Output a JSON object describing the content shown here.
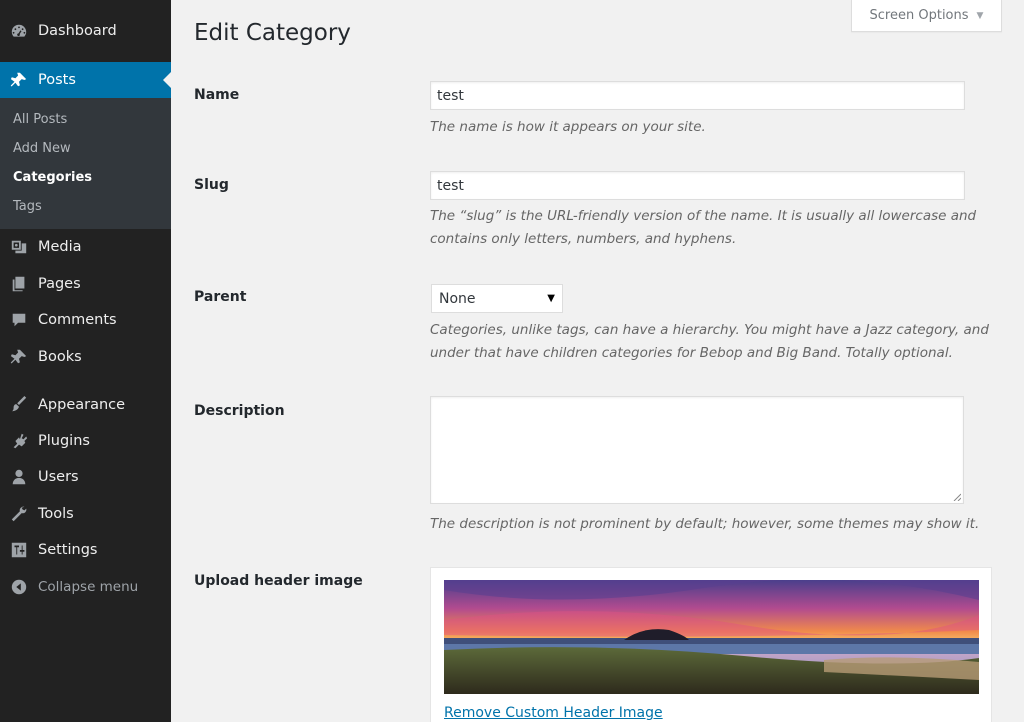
{
  "sidebar": {
    "items": [
      {
        "label": "Dashboard",
        "icon": "dashboard-icon"
      },
      {
        "label": "Posts",
        "icon": "pushpin-icon",
        "active": true
      },
      {
        "label": "Media",
        "icon": "media-icon"
      },
      {
        "label": "Pages",
        "icon": "pages-icon"
      },
      {
        "label": "Comments",
        "icon": "comments-icon"
      },
      {
        "label": "Books",
        "icon": "pushpin-icon"
      },
      {
        "label": "Appearance",
        "icon": "paintbrush-icon"
      },
      {
        "label": "Plugins",
        "icon": "plug-icon"
      },
      {
        "label": "Users",
        "icon": "users-icon"
      },
      {
        "label": "Tools",
        "icon": "wrench-icon"
      },
      {
        "label": "Settings",
        "icon": "settings-icon"
      }
    ],
    "submenu": [
      "All Posts",
      "Add New",
      "Categories",
      "Tags"
    ],
    "collapse_label": "Collapse menu"
  },
  "header": {
    "screen_options": "Screen Options",
    "title": "Edit Category"
  },
  "form": {
    "name": {
      "label": "Name",
      "value": "test",
      "help": "The name is how it appears on your site."
    },
    "slug": {
      "label": "Slug",
      "value": "test",
      "help_line1": "The “slug” is the URL-friendly version of the name. It is usually all lowercase and",
      "help_line2": "contains only letters, numbers, and hyphens."
    },
    "parent": {
      "label": "Parent",
      "selected": "None",
      "help_line1": "Categories, unlike tags, can have a hierarchy. You might have a Jazz category, and",
      "help_line2": "under that have children categories for Bebop and Big Band. Totally optional."
    },
    "description": {
      "label": "Description",
      "value": "",
      "help": "The description is not prominent by default; however, some themes may show it."
    },
    "header_image": {
      "label": "Upload header image",
      "remove_link": "Remove Custom Header Image"
    }
  },
  "colors": {
    "sidebar_bg": "#222222",
    "submenu_bg": "#32373c",
    "accent": "#0073aa",
    "page_bg": "#f1f1f1"
  }
}
